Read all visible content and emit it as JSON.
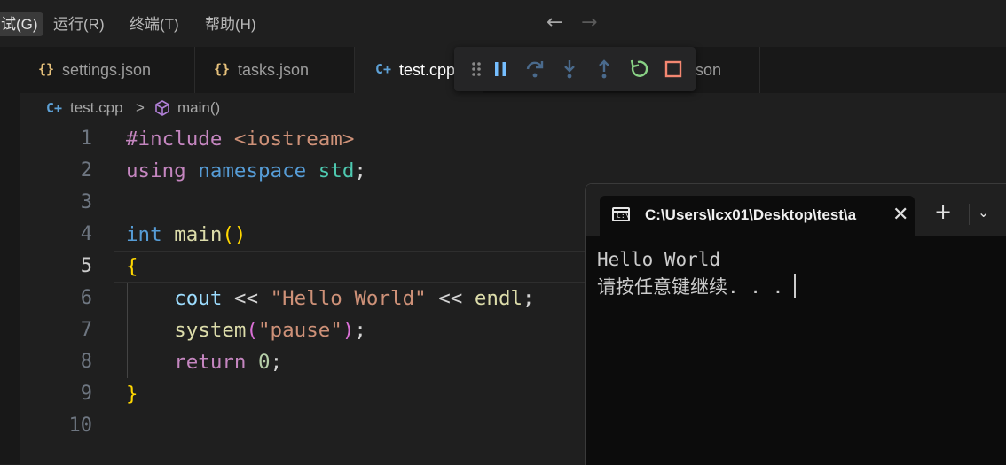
{
  "menubar": {
    "items": [
      "调试(G)",
      "运行(R)",
      "终端(T)",
      "帮助(H)"
    ],
    "back_arrow": "←",
    "forward_arrow": "→"
  },
  "tabs": [
    {
      "icon_text": "{}",
      "label": "settings.json"
    },
    {
      "icon_text": "{}",
      "label": "tasks.json"
    },
    {
      "icon_text": "C+",
      "label": "test.cpp"
    },
    {
      "icon_text": "{}",
      "label": "son"
    }
  ],
  "breadcrumb": {
    "file": "test.cpp",
    "separator": ">",
    "symbol": "main()"
  },
  "editor": {
    "current_line": 5,
    "line_numbers": [
      "1",
      "2",
      "3",
      "4",
      "5",
      "6",
      "7",
      "8",
      "9",
      "10"
    ]
  },
  "debug_toolbar": {
    "buttons": [
      "drag-handle",
      "pause",
      "step-over",
      "step-into",
      "step-out",
      "restart",
      "stop"
    ]
  },
  "terminal": {
    "tab_title": "C:\\Users\\lcx01\\Desktop\\test\\a",
    "new_tab": "+",
    "dropdown": "⌄",
    "output": [
      "Hello World",
      "请按任意键继续. . ."
    ]
  },
  "colors": {
    "keyword": "#c586c0",
    "namespace": "#569cd6",
    "type": "#4ec9b0",
    "string": "#ce9178",
    "number": "#b5cea8",
    "function": "#dcdcaa",
    "brace": "#ffd700",
    "restart": "#89d185",
    "stop": "#f48771"
  }
}
